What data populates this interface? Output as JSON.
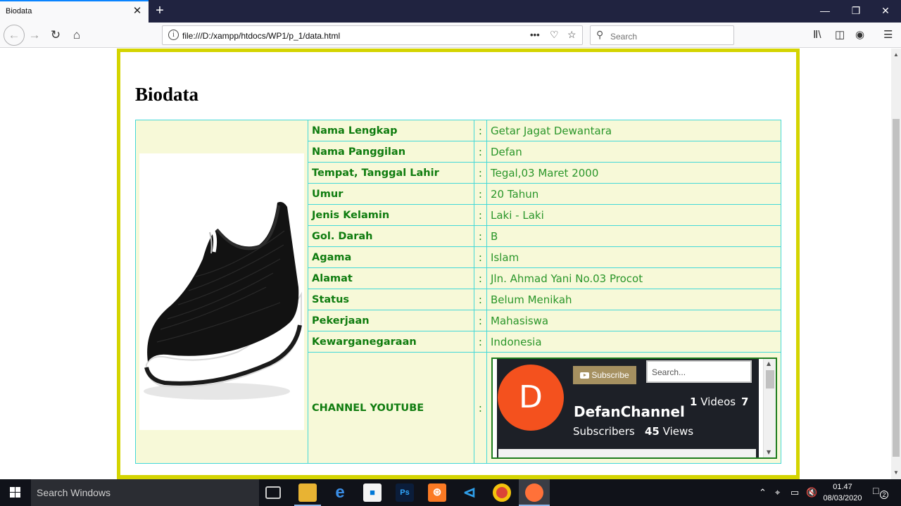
{
  "browser": {
    "tab_title": "Biodata",
    "tab_close": "✕",
    "new_tab": "+",
    "url": "file:///D:/xampp/htdocs/WP1/p_1/data.html",
    "search_placeholder": "Search",
    "page_actions": "•••"
  },
  "page": {
    "title": "Biodata",
    "rows": [
      {
        "label": "Nama Lengkap",
        "colon": ":",
        "value": "Getar Jagat Dewantara"
      },
      {
        "label": "Nama Panggilan",
        "colon": ":",
        "value": "Defan"
      },
      {
        "label": "Tempat, Tanggal Lahir",
        "colon": ":",
        "value": "Tegal,03 Maret 2000"
      },
      {
        "label": "Umur",
        "colon": ":",
        "value": "20 Tahun"
      },
      {
        "label": "Jenis Kelamin",
        "colon": ":",
        "value": "Laki - Laki"
      },
      {
        "label": "Gol. Darah",
        "colon": ":",
        "value": "B"
      },
      {
        "label": "Agama",
        "colon": ":",
        "value": "Islam"
      },
      {
        "label": "Alamat",
        "colon": ":",
        "value": "Jln. Ahmad Yani No.03 Procot"
      },
      {
        "label": "Status",
        "colon": ":",
        "value": "Belum Menikah"
      },
      {
        "label": "Pekerjaan",
        "colon": ":",
        "value": "Mahasiswa"
      },
      {
        "label": "Kewarganegaraan",
        "colon": ":",
        "value": "Indonesia"
      }
    ],
    "youtube": {
      "label": "CHANNEL YOUTUBE",
      "colon": ":",
      "avatar_letter": "D",
      "subscribe": "Subscribe",
      "search_placeholder": "Search...",
      "channel_name": "DefanChannel",
      "videos_count": "1",
      "videos_label": "Videos",
      "subscribers_count": "7",
      "subscribers_label": "Subscribers",
      "views_count": "45",
      "views_label": "Views"
    }
  },
  "taskbar": {
    "search_text": "Search Windows",
    "time": "01.47",
    "date": "08/03/2020",
    "notifications": "2"
  },
  "colors": {
    "frame_border": "#d4d400",
    "table_border": "#44d8d8",
    "cell_bg": "#f7f9d8",
    "text_green": "#1f8a1f",
    "avatar": "#f4511e",
    "subscribe_button": "#a59060"
  }
}
